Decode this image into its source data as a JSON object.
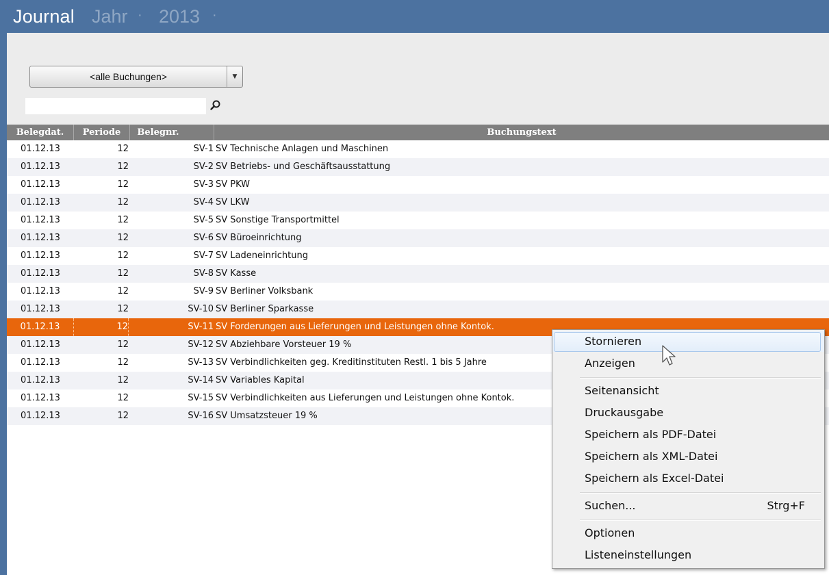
{
  "title": {
    "main": "Journal",
    "sub": "Jahr",
    "year": "2013",
    "separator": "·"
  },
  "filter": {
    "selected": "<alle Buchungen>",
    "search_value": "",
    "search_icon": "search-icon"
  },
  "table": {
    "headers": [
      "Belegdat.",
      "Periode",
      "Belegnr.",
      "Buchungstext"
    ],
    "rows": [
      {
        "date": "01.12.13",
        "period": "12",
        "nr": "SV-1",
        "text": "SV Technische Anlagen und Maschinen"
      },
      {
        "date": "01.12.13",
        "period": "12",
        "nr": "SV-2",
        "text": "SV Betriebs- und Geschäftsausstattung"
      },
      {
        "date": "01.12.13",
        "period": "12",
        "nr": "SV-3",
        "text": "SV PKW"
      },
      {
        "date": "01.12.13",
        "period": "12",
        "nr": "SV-4",
        "text": "SV LKW"
      },
      {
        "date": "01.12.13",
        "period": "12",
        "nr": "SV-5",
        "text": "SV Sonstige Transportmittel"
      },
      {
        "date": "01.12.13",
        "period": "12",
        "nr": "SV-6",
        "text": "SV Büroeinrichtung"
      },
      {
        "date": "01.12.13",
        "period": "12",
        "nr": "SV-7",
        "text": "SV Ladeneinrichtung"
      },
      {
        "date": "01.12.13",
        "period": "12",
        "nr": "SV-8",
        "text": "SV Kasse"
      },
      {
        "date": "01.12.13",
        "period": "12",
        "nr": "SV-9",
        "text": "SV Berliner Volksbank"
      },
      {
        "date": "01.12.13",
        "period": "12",
        "nr": "SV-10",
        "text": "SV Berliner Sparkasse"
      },
      {
        "date": "01.12.13",
        "period": "12",
        "nr": "SV-11",
        "text": "SV Forderungen aus Lieferungen und Leistungen ohne Kontok."
      },
      {
        "date": "01.12.13",
        "period": "12",
        "nr": "SV-12",
        "text": "SV Abziehbare Vorsteuer 19 %"
      },
      {
        "date": "01.12.13",
        "period": "12",
        "nr": "SV-13",
        "text": "SV Verbindlichkeiten geg. Kreditinstituten Restl. 1 bis 5 Jahre"
      },
      {
        "date": "01.12.13",
        "period": "12",
        "nr": "SV-14",
        "text": "SV Variables Kapital"
      },
      {
        "date": "01.12.13",
        "period": "12",
        "nr": "SV-15",
        "text": "SV Verbindlichkeiten aus Lieferungen und Leistungen ohne Kontok."
      },
      {
        "date": "01.12.13",
        "period": "12",
        "nr": "SV-16",
        "text": "SV Umsatzsteuer 19 %"
      }
    ],
    "selected_row": "SV-11"
  },
  "context_menu": {
    "groups": [
      [
        {
          "label": "Stornieren",
          "highlighted": true
        },
        {
          "label": "Anzeigen"
        }
      ],
      [
        {
          "label": "Seitenansicht"
        },
        {
          "label": "Druckausgabe"
        },
        {
          "label": "Speichern als PDF-Datei"
        },
        {
          "label": "Speichern als XML-Datei"
        },
        {
          "label": "Speichern als Excel-Datei"
        }
      ],
      [
        {
          "label": "Suchen...",
          "shortcut": "Strg+F"
        }
      ],
      [
        {
          "label": "Optionen"
        },
        {
          "label": "Listeneinstellungen"
        }
      ]
    ]
  },
  "colors": {
    "titlebar": "#4c72a0",
    "selected_row": "#e8660c",
    "header": "#7f7f7f"
  }
}
